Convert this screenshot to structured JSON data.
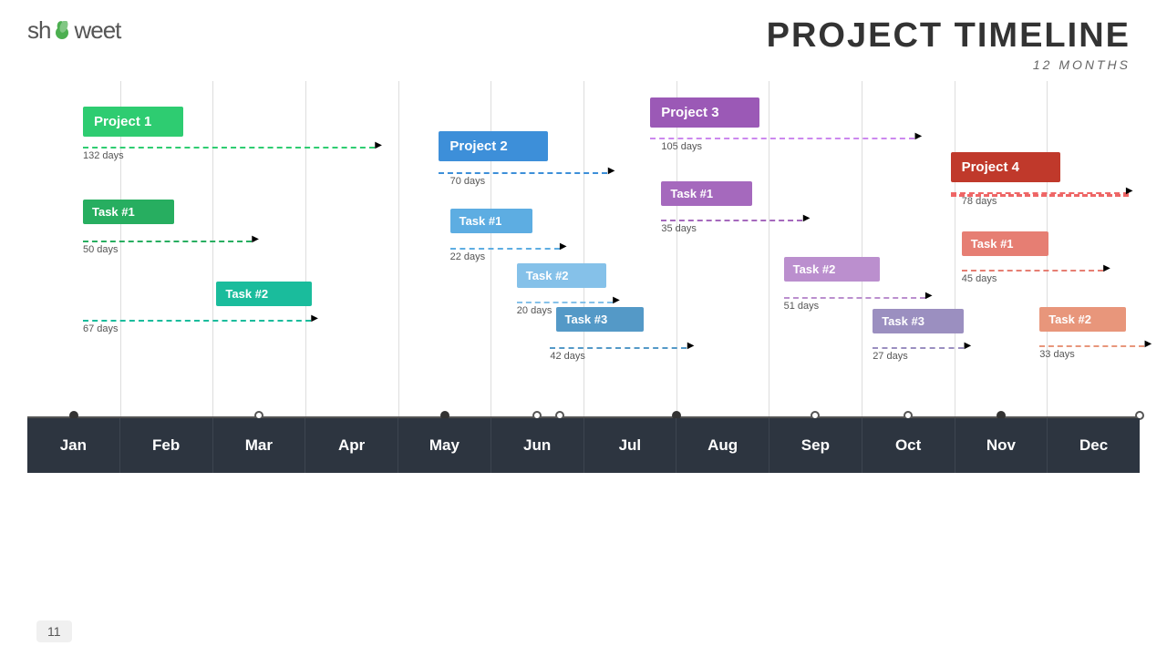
{
  "logo": {
    "text_before": "sh",
    "text_after": "weet"
  },
  "header": {
    "title": "Project Timeline",
    "subtitle": "12 Months"
  },
  "months": [
    "Jan",
    "Feb",
    "Mar",
    "Apr",
    "May",
    "Jun",
    "Jul",
    "Aug",
    "Sep",
    "Oct",
    "Nov",
    "Dec"
  ],
  "projects": [
    {
      "id": "p1",
      "label": "Project 1",
      "color": "#2ecc71",
      "days": "132 days"
    },
    {
      "id": "p2",
      "label": "Project 2",
      "color": "#3d8fd9",
      "days": "70 days"
    },
    {
      "id": "p3",
      "label": "Project 3",
      "color": "#9b59b6",
      "days": "105 days"
    },
    {
      "id": "p4",
      "label": "Project 4",
      "color": "#c0392b",
      "days": "78 days"
    }
  ],
  "tasks": [
    {
      "id": "p1t1",
      "label": "Task #1",
      "color": "#27ae60",
      "days": "50 days"
    },
    {
      "id": "p1t2",
      "label": "Task #2",
      "color": "#1abc9c",
      "days": "67 days"
    },
    {
      "id": "p2t1",
      "label": "Task #1",
      "color": "#5dade2",
      "days": "22 days"
    },
    {
      "id": "p2t2",
      "label": "Task #2",
      "color": "#85c1e9",
      "days": "20 days"
    },
    {
      "id": "p2t3",
      "label": "Task #3",
      "color": "#5499c7",
      "days": "42 days"
    },
    {
      "id": "p3t1",
      "label": "Task #1",
      "color": "#a569bd",
      "days": "35 days"
    },
    {
      "id": "p3t2",
      "label": "Task #2",
      "color": "#bb8fce",
      "days": "51 days"
    },
    {
      "id": "p3t3",
      "label": "Task #3",
      "color": "#9b8fc0",
      "days": "27 days"
    },
    {
      "id": "p4t1",
      "label": "Task #1",
      "color": "#e67e73",
      "days": "45 days"
    },
    {
      "id": "p4t2",
      "label": "Task #2",
      "color": "#e8967b",
      "days": "33 days"
    }
  ],
  "page_number": "11"
}
